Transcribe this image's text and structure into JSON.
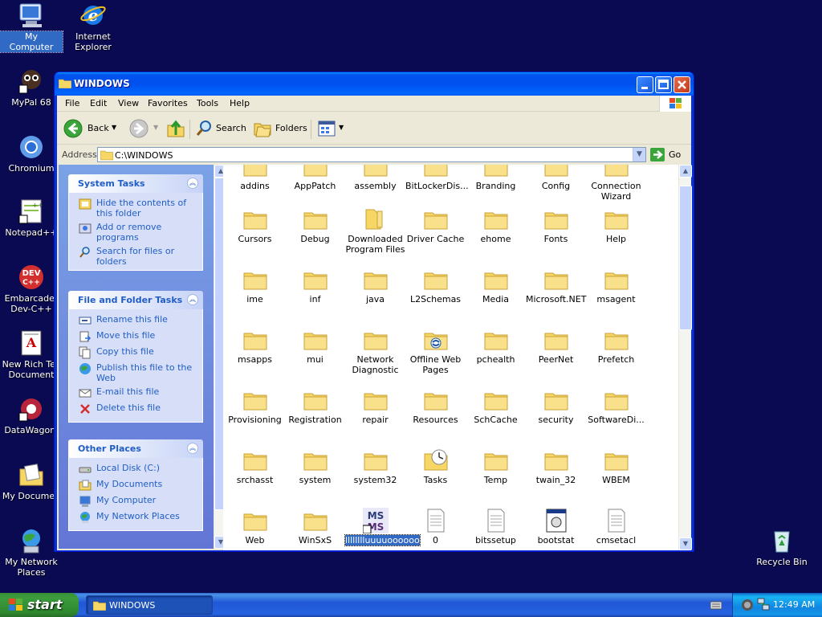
{
  "desktop": {
    "icons": [
      {
        "label": "My Computer"
      },
      {
        "label": "Internet Explorer"
      },
      {
        "label": "MyPal 68"
      },
      {
        "label": "Chromium"
      },
      {
        "label": "Notepad++"
      },
      {
        "label": "Embarcader Dev-C++"
      },
      {
        "label": "New Rich Tex Document"
      },
      {
        "label": "DataWagon."
      },
      {
        "label": "My Documen"
      },
      {
        "label": "My Network Places"
      },
      {
        "label": "Recycle Bin"
      }
    ]
  },
  "window": {
    "title": "WINDOWS",
    "menu": [
      "File",
      "Edit",
      "View",
      "Favorites",
      "Tools",
      "Help"
    ],
    "toolbar": {
      "back": "Back",
      "search": "Search",
      "folders": "Folders"
    },
    "address": {
      "label": "Address",
      "value": "C:\\WINDOWS",
      "go": "Go"
    },
    "panels": {
      "system_tasks": {
        "title": "System Tasks",
        "items": [
          "Hide the contents of this folder",
          "Add or remove programs",
          "Search for files or folders"
        ]
      },
      "file_tasks": {
        "title": "File and Folder Tasks",
        "items": [
          "Rename this file",
          "Move this file",
          "Copy this file",
          "Publish this file to the Web",
          "E-mail this file",
          "Delete this file"
        ]
      },
      "other_places": {
        "title": "Other Places",
        "items": [
          "Local Disk (C:)",
          "My Documents",
          "My Computer",
          "My Network Places"
        ]
      }
    },
    "files": [
      "addins",
      "AppPatch",
      "assembly",
      "BitLockerDis...",
      "Branding",
      "Config",
      "Connection Wizard",
      "Cursors",
      "Debug",
      "Downloaded Program Files",
      "Driver Cache",
      "ehome",
      "Fonts",
      "Help",
      "ime",
      "inf",
      "java",
      "L2Schemas",
      "Media",
      "Microsoft.NET",
      "msagent",
      "msapps",
      "mui",
      "Network Diagnostic",
      "Offline Web Pages",
      "pchealth",
      "PeerNet",
      "Prefetch",
      "Provisioning",
      "Registration",
      "repair",
      "Resources",
      "SchCache",
      "security",
      "SoftwareDi...",
      "srchasst",
      "system",
      "system32",
      "Tasks",
      "Temp",
      "twain_32",
      "WBEM",
      "Web",
      "WinSxS",
      "lllllllluuuuoooooo",
      "0",
      "bitssetup",
      "bootstat",
      "cmsetacl"
    ]
  },
  "taskbar": {
    "start": "start",
    "task": "WINDOWS",
    "clock": "12:49 AM"
  },
  "colors": {
    "desktop": "#0a0a52",
    "titlebar": "#0053ee",
    "panel_link": "#215dc6",
    "selection": "#316ac5"
  }
}
